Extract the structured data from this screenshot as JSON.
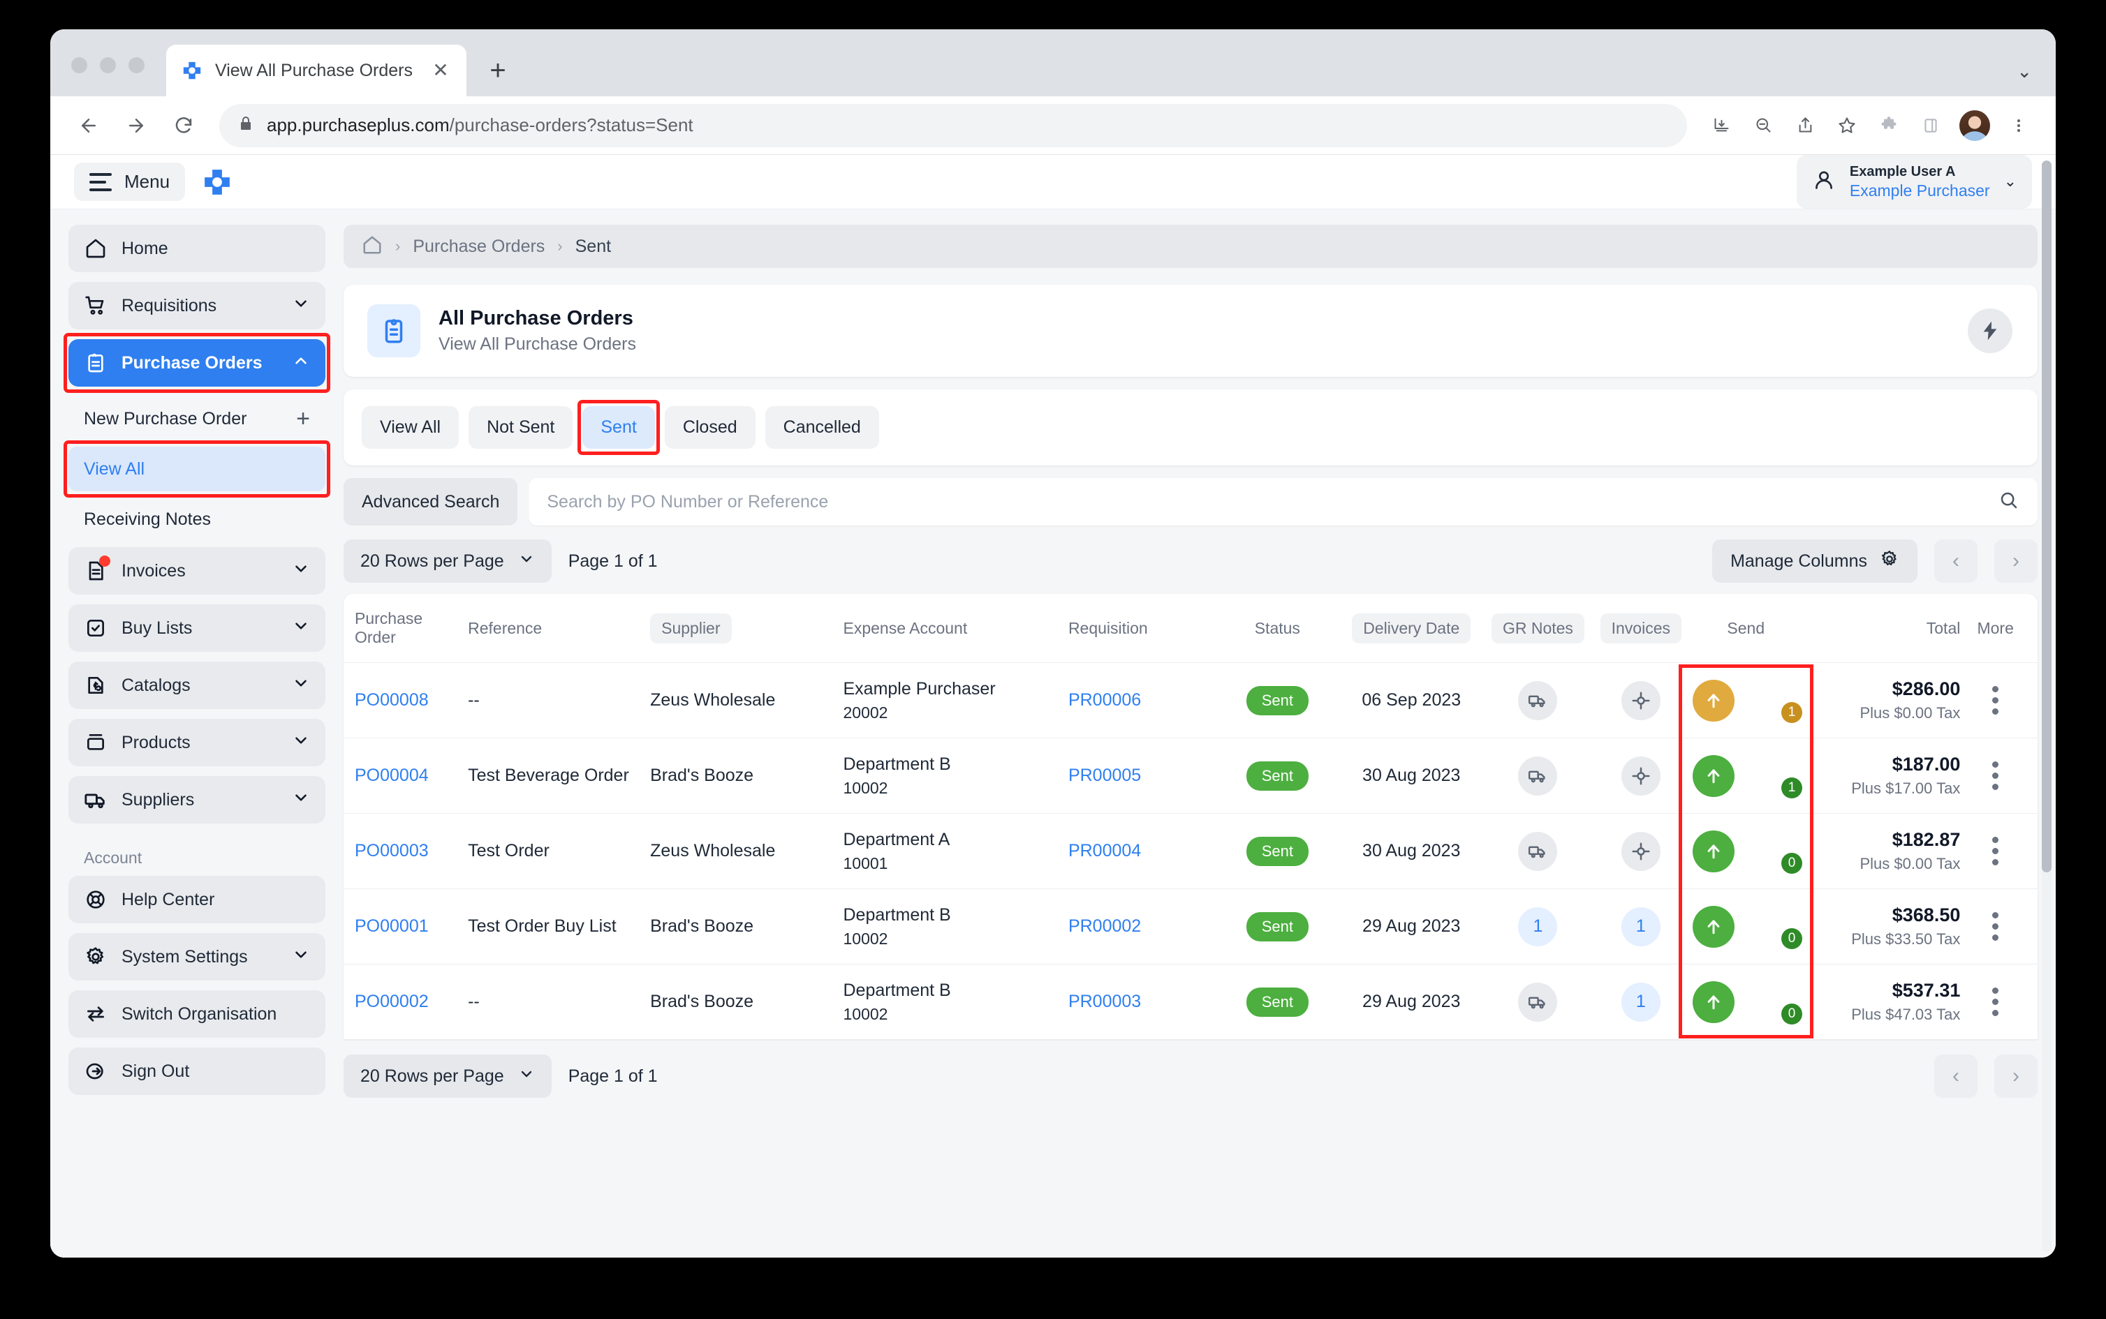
{
  "browser": {
    "tab_title": "View All Purchase Orders",
    "close_label": "✕",
    "newtab_label": "+",
    "tabstrip_more": "⌄",
    "url_bold": "app.purchaseplus.com",
    "url_dim": "/purchase-orders?status=Sent",
    "icons": {
      "back": "back-arrow-icon",
      "forward": "forward-arrow-icon",
      "reload": "reload-icon",
      "lock": "lock-icon",
      "install": "install-app-icon",
      "zoom": "zoom-out-icon",
      "share": "share-icon",
      "bookmark": "star-icon",
      "extensions": "puzzle-piece-icon",
      "sidepanel": "side-panel-icon",
      "profile": "profile-avatar",
      "more": "three-dot-menu-icon"
    }
  },
  "appbar": {
    "menu_label": "Menu",
    "user_name": "Example User A",
    "user_role": "Example Purchaser",
    "chevron": "⌄"
  },
  "sidebar": {
    "items": [
      {
        "label": "Home",
        "icon": "home-icon",
        "caret": false,
        "active": false,
        "badge": false
      },
      {
        "label": "Requisitions",
        "icon": "cart-icon",
        "caret": true,
        "active": false,
        "badge": false
      },
      {
        "label": "Purchase Orders",
        "icon": "clipboard-icon",
        "caret": true,
        "active": true,
        "expanded": true,
        "badge": false,
        "highlight": true
      }
    ],
    "sub_items": [
      {
        "label": "New Purchase Order",
        "trailing": "+",
        "selected": false
      },
      {
        "label": "View All",
        "trailing": "",
        "selected": true,
        "highlight": true
      },
      {
        "label": "Receiving Notes",
        "trailing": "",
        "selected": false
      }
    ],
    "items2": [
      {
        "label": "Invoices",
        "icon": "invoice-icon",
        "caret": true,
        "badge": true
      },
      {
        "label": "Buy Lists",
        "icon": "checklist-icon",
        "caret": true,
        "badge": false
      },
      {
        "label": "Catalogs",
        "icon": "catalog-icon",
        "caret": true,
        "badge": false
      },
      {
        "label": "Products",
        "icon": "products-icon",
        "caret": true,
        "badge": false
      },
      {
        "label": "Suppliers",
        "icon": "truck-icon",
        "caret": true,
        "badge": false
      }
    ],
    "account_label": "Account",
    "account_items": [
      {
        "label": "Help Center",
        "icon": "lifebuoy-icon",
        "caret": false
      },
      {
        "label": "System Settings",
        "icon": "gear-icon",
        "caret": true
      },
      {
        "label": "Switch Organisation",
        "icon": "swap-icon",
        "caret": false
      },
      {
        "label": "Sign Out",
        "icon": "sign-out-icon",
        "caret": false
      }
    ]
  },
  "breadcrumb": {
    "home_icon": "home-icon",
    "items": [
      "Purchase Orders",
      "Sent"
    ],
    "separator": "›"
  },
  "pagehead": {
    "icon": "clipboard-icon",
    "title": "All Purchase Orders",
    "subtitle": "View All Purchase Orders",
    "action_icon": "lightning-bolt-icon"
  },
  "filter_tabs": [
    {
      "label": "View All",
      "active": false
    },
    {
      "label": "Not Sent",
      "active": false
    },
    {
      "label": "Sent",
      "active": true,
      "highlight": true
    },
    {
      "label": "Closed",
      "active": false
    },
    {
      "label": "Cancelled",
      "active": false
    }
  ],
  "search": {
    "advanced_label": "Advanced Search",
    "placeholder": "Search by PO Number or Reference",
    "value": "",
    "icon": "search-icon"
  },
  "toolbar": {
    "rows_per_page": "20 Rows per Page",
    "page_text": "Page 1 of 1",
    "manage_columns": "Manage Columns",
    "gear_icon": "gear-icon",
    "prev": "‹",
    "next": "›"
  },
  "table": {
    "columns": [
      {
        "label": "Purchase Order",
        "pill": false,
        "align": "left"
      },
      {
        "label": "Reference",
        "pill": false,
        "align": "left"
      },
      {
        "label": "Supplier",
        "pill": true,
        "align": "left"
      },
      {
        "label": "Expense Account",
        "pill": false,
        "align": "left"
      },
      {
        "label": "Requisition",
        "pill": false,
        "align": "left"
      },
      {
        "label": "Status",
        "pill": false,
        "align": "center"
      },
      {
        "label": "Delivery Date",
        "pill": true,
        "align": "center"
      },
      {
        "label": "GR Notes",
        "pill": true,
        "align": "center"
      },
      {
        "label": "Invoices",
        "pill": true,
        "align": "center"
      },
      {
        "label": "Send",
        "pill": false,
        "align": "center"
      },
      {
        "label": "Total",
        "pill": false,
        "align": "right"
      },
      {
        "label": "More",
        "pill": false,
        "align": "center"
      }
    ],
    "rows": [
      {
        "po": "PO00008",
        "reference": "--",
        "supplier": "Zeus Wholesale",
        "account_name": "Example Purchaser",
        "account_code": "20002",
        "requisition": "PR00006",
        "status": "Sent",
        "delivery_date": "06 Sep 2023",
        "gr_notes": {
          "type": "icon",
          "icon": "truck-icon",
          "value": ""
        },
        "invoices": {
          "type": "icon",
          "icon": "target-icon",
          "value": ""
        },
        "send": {
          "color": "#e0aa3e",
          "badge_color": "#c8901f",
          "count": "1"
        },
        "total": "$286.00",
        "tax": "Plus $0.00 Tax"
      },
      {
        "po": "PO00004",
        "reference": "Test Beverage Order",
        "supplier": "Brad's Booze",
        "account_name": "Department B",
        "account_code": "10002",
        "requisition": "PR00005",
        "status": "Sent",
        "delivery_date": "30 Aug 2023",
        "gr_notes": {
          "type": "icon",
          "icon": "truck-icon",
          "value": ""
        },
        "invoices": {
          "type": "icon",
          "icon": "target-icon",
          "value": ""
        },
        "send": {
          "color": "#4caf3f",
          "badge_color": "#2e8b27",
          "count": "1"
        },
        "total": "$187.00",
        "tax": "Plus $17.00 Tax"
      },
      {
        "po": "PO00003",
        "reference": "Test Order",
        "supplier": "Zeus Wholesale",
        "account_name": "Department A",
        "account_code": "10001",
        "requisition": "PR00004",
        "status": "Sent",
        "delivery_date": "30 Aug 2023",
        "gr_notes": {
          "type": "icon",
          "icon": "truck-icon",
          "value": ""
        },
        "invoices": {
          "type": "icon",
          "icon": "target-icon",
          "value": ""
        },
        "send": {
          "color": "#4caf3f",
          "badge_color": "#2e8b27",
          "count": "0"
        },
        "total": "$182.87",
        "tax": "Plus $0.00 Tax"
      },
      {
        "po": "PO00001",
        "reference": "Test Order Buy List",
        "supplier": "Brad's Booze",
        "account_name": "Department B",
        "account_code": "10002",
        "requisition": "PR00002",
        "status": "Sent",
        "delivery_date": "29 Aug 2023",
        "gr_notes": {
          "type": "num",
          "icon": "",
          "value": "1"
        },
        "invoices": {
          "type": "num",
          "icon": "",
          "value": "1"
        },
        "send": {
          "color": "#4caf3f",
          "badge_color": "#2e8b27",
          "count": "0"
        },
        "total": "$368.50",
        "tax": "Plus $33.50 Tax"
      },
      {
        "po": "PO00002",
        "reference": "--",
        "supplier": "Brad's Booze",
        "account_name": "Department B",
        "account_code": "10002",
        "requisition": "PR00003",
        "status": "Sent",
        "delivery_date": "29 Aug 2023",
        "gr_notes": {
          "type": "icon",
          "icon": "truck-icon",
          "value": ""
        },
        "invoices": {
          "type": "num",
          "icon": "",
          "value": "1"
        },
        "send": {
          "color": "#4caf3f",
          "badge_color": "#2e8b27",
          "count": "0"
        },
        "total": "$537.31",
        "tax": "Plus $47.03 Tax"
      }
    ]
  },
  "bottom": {
    "rows_per_page": "20 Rows per Page",
    "page_text": "Page 1 of 1",
    "prev": "‹",
    "next": "›"
  },
  "colors": {
    "accent": "#2f7ff0",
    "status_green": "#4caf3f",
    "send_pending": "#e0aa3e",
    "highlight_red": "#ff1f1f"
  }
}
